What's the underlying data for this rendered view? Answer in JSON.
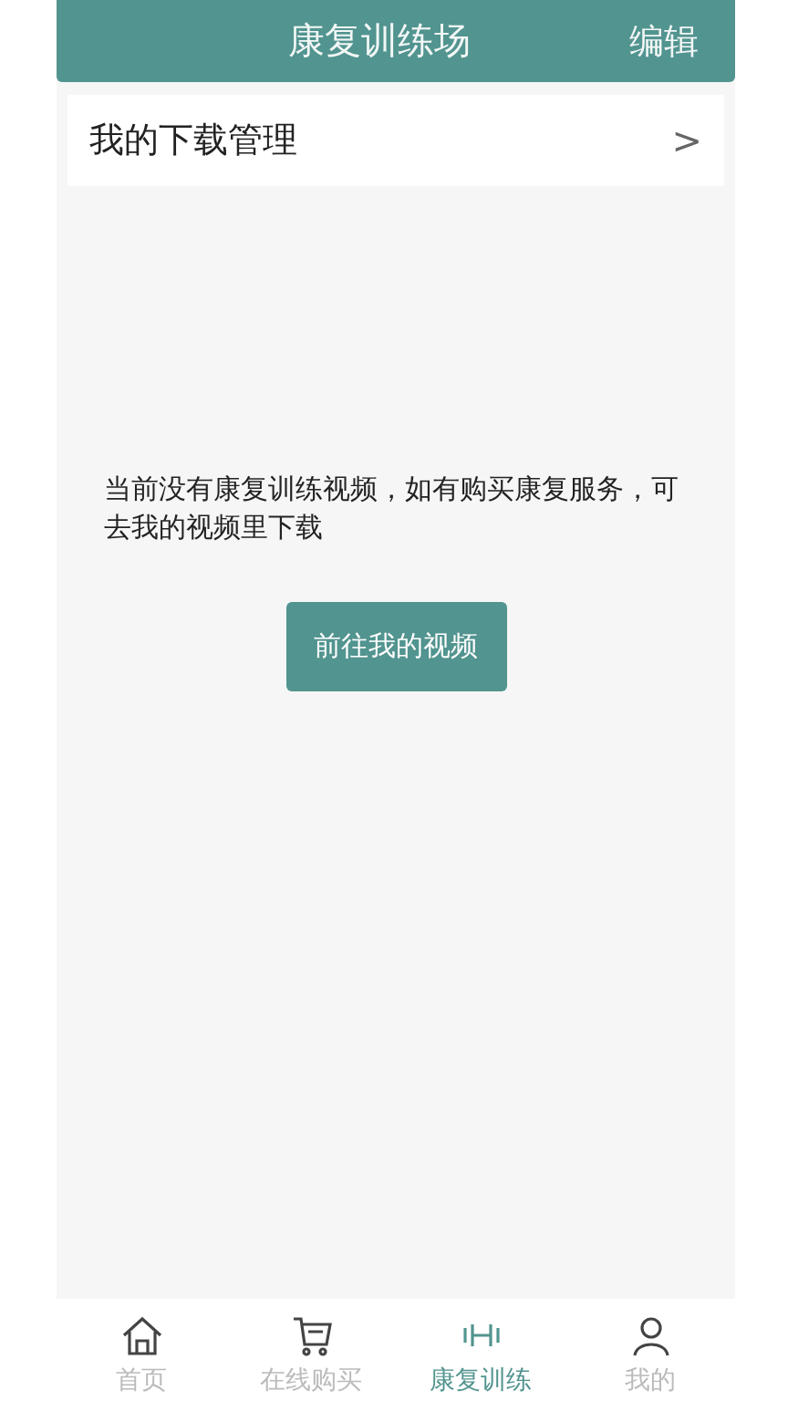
{
  "header": {
    "title": "康复训练场",
    "action": "编辑"
  },
  "menu_row": {
    "label": "我的下载管理",
    "chevron": ">"
  },
  "empty_state": {
    "message": "当前没有康复训练视频，如有购买康复服务，可去我的视频里下载",
    "button": "前往我的视频"
  },
  "tab_bar": [
    {
      "label": "首页",
      "kind": "home",
      "selected": false
    },
    {
      "label": "在线购买",
      "kind": "cart",
      "selected": false
    },
    {
      "label": "康复训练",
      "kind": "train",
      "selected": true
    },
    {
      "label": "我的",
      "kind": "user",
      "selected": false
    }
  ]
}
